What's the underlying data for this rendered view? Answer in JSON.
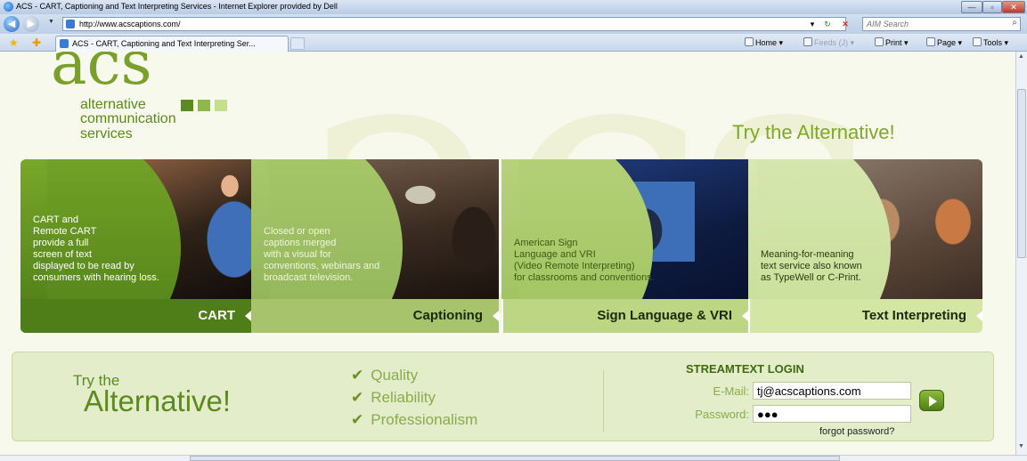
{
  "browser": {
    "window_title": "ACS - CART, Captioning and Text Interpreting Services - Internet Explorer provided by Dell",
    "url": "http://www.acscaptions.com/",
    "search_placeholder": "AIM Search",
    "tab_label": "ACS - CART, Captioning and Text Interpreting Ser...",
    "commands": {
      "home": "Home",
      "feeds": "Feeds (J)",
      "print": "Print",
      "page": "Page",
      "tools": "Tools"
    }
  },
  "site": {
    "logo_text": "acs",
    "logo_lines": [
      "alternative",
      "communication",
      "services"
    ],
    "logo_square_colors": [
      "#5d8a1e",
      "#8db84a",
      "#c4e08a"
    ],
    "tagline": "Try the Alternative!",
    "services": [
      {
        "label": "CART",
        "description": [
          "CART and",
          "Remote CART",
          "provide a full",
          "screen of text",
          "displayed to be read by",
          "consumers with hearing loss."
        ]
      },
      {
        "label": "Captioning",
        "description": [
          "Closed or open",
          "captions merged",
          "with a visual for",
          "conventions, webinars and",
          "broadcast television."
        ]
      },
      {
        "label": "Sign Language & VRI",
        "description": [
          "American Sign",
          "Language and VRI",
          "(Video Remote Interpreting)",
          "for classrooms and conventions."
        ]
      },
      {
        "label": "Text Interpreting",
        "description": [
          "Meaning-for-meaning",
          "text service also known",
          "as TypeWell or C-Print."
        ]
      }
    ],
    "promo": {
      "try_small": "Try the",
      "try_big": "Alternative!",
      "checks": [
        "Quality",
        "Reliability",
        "Professionalism"
      ]
    },
    "login": {
      "title": "STREAMTEXT LOGIN",
      "email_label": "E-Mail:",
      "email_value": "tj@acscaptions.com",
      "password_label": "Password:",
      "password_value": "●●●",
      "forgot": "forgot password?"
    }
  }
}
